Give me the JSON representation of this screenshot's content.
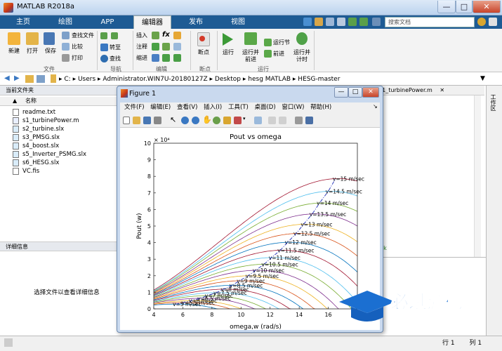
{
  "app": {
    "title": "MATLAB R2018a",
    "tabs": [
      {
        "label": "主页"
      },
      {
        "label": "绘图"
      },
      {
        "label": "APP"
      },
      {
        "label": "编辑器"
      },
      {
        "label": "发布"
      },
      {
        "label": "视图"
      }
    ],
    "search_placeholder": "搜索文档",
    "window_buttons": {
      "minimize": "—",
      "maximize": "□",
      "close": "✕"
    }
  },
  "ribbon": {
    "file": {
      "new": "新建",
      "open": "打开",
      "save": "保存",
      "find_file": "查找文件",
      "compare": "比较",
      "print": "打印",
      "section": "文件"
    },
    "nav": {
      "goto": "转至",
      "find": "查找",
      "section": "导航"
    },
    "edit": {
      "insert": "插入",
      "comment": "注释",
      "indent": "缩进",
      "fx": "fx",
      "section": "编辑"
    },
    "breakpoints": {
      "label": "断点",
      "section": "断点"
    },
    "run": {
      "run": "运行",
      "run_advance": "运行并\n前进",
      "run_section": "运行节",
      "advance": "前进",
      "run_time": "运行并\n计时",
      "section": "运行"
    }
  },
  "address": {
    "parts": [
      "C:",
      "Users",
      "Administrator.WIN7U-20180127Z",
      "Desktop",
      "hesg MATLAB",
      "HESG-master"
    ]
  },
  "file_panel": {
    "title": "当前文件夹",
    "col_name": "名称",
    "sort": "▲",
    "files": [
      "readme.txt",
      "s1_turbinePower.m",
      "s2_turbine.slx",
      "s3_PMSG.slx",
      "s4_boost.slx",
      "s5_Inverter_PSMG.slx",
      "s6_HESG.slx",
      "VC.fis"
    ]
  },
  "details": {
    "title": "详细信息",
    "message": "选择文件以查看详细信息"
  },
  "editor": {
    "tab": "s1_turbinePower.m",
    "workspace": "工作区",
    "peek": "5k"
  },
  "status": {
    "row_label": "行",
    "row": "1",
    "col_label": "列",
    "col": "1"
  },
  "figure": {
    "title": "Figure 1",
    "menu": [
      "文件(F)",
      "编辑(E)",
      "查看(V)",
      "插入(I)",
      "工具(T)",
      "桌面(D)",
      "窗口(W)",
      "帮助(H)"
    ]
  },
  "watermark": {
    "cn": "必过源码",
    "url": "Biguo100.com"
  },
  "chart_data": {
    "type": "line",
    "title": "Pout vs omega",
    "xlabel": "omega,w (rad/s)",
    "ylabel": "Pout (w)",
    "y_exponent": "× 10⁴",
    "xlim": [
      4,
      18
    ],
    "ylim": [
      0,
      100000
    ],
    "x_ticks": [
      4,
      6,
      8,
      10,
      12,
      14,
      16,
      18
    ],
    "y_ticks": [
      0,
      1,
      2,
      3,
      4,
      5,
      6,
      7,
      8,
      9,
      10
    ],
    "grid": false,
    "series": [
      {
        "name": "v=5 m/sec",
        "v": 5,
        "peak_x": 5.5,
        "peak_y": 2900
      },
      {
        "name": "v=5.5 m/sec",
        "v": 5.5,
        "peak_x": 6.1,
        "peak_y": 3900
      },
      {
        "name": "v=6 m/sec",
        "v": 6,
        "peak_x": 6.6,
        "peak_y": 5000
      },
      {
        "name": "v=6.5 m/sec",
        "v": 6.5,
        "peak_x": 7.2,
        "peak_y": 6400
      },
      {
        "name": "v=7 m/sec",
        "v": 7,
        "peak_x": 7.7,
        "peak_y": 8000
      },
      {
        "name": "v=7.5 m/sec",
        "v": 7.5,
        "peak_x": 8.3,
        "peak_y": 9800
      },
      {
        "name": "v=8 m/sec",
        "v": 8,
        "peak_x": 8.8,
        "peak_y": 11900
      },
      {
        "name": "v=8.5 m/sec",
        "v": 8.5,
        "peak_x": 9.4,
        "peak_y": 14300
      },
      {
        "name": "v=9 m/sec",
        "v": 9,
        "peak_x": 9.9,
        "peak_y": 17000
      },
      {
        "name": "v=9.5 m/sec",
        "v": 9.5,
        "peak_x": 10.5,
        "peak_y": 20000
      },
      {
        "name": "v=10 m/sec",
        "v": 10,
        "peak_x": 11.0,
        "peak_y": 23300
      },
      {
        "name": "v=10.5 m/sec",
        "v": 10.5,
        "peak_x": 11.6,
        "peak_y": 27000
      },
      {
        "name": "v=11 m/sec",
        "v": 11,
        "peak_x": 12.1,
        "peak_y": 31000
      },
      {
        "name": "v=11.5 m/sec",
        "v": 11.5,
        "peak_x": 12.7,
        "peak_y": 35400
      },
      {
        "name": "v=12 m/sec",
        "v": 12,
        "peak_x": 13.2,
        "peak_y": 40200
      },
      {
        "name": "v=12.5 m/sec",
        "v": 12.5,
        "peak_x": 13.8,
        "peak_y": 45500
      },
      {
        "name": "v=13 m/sec",
        "v": 13,
        "peak_x": 14.3,
        "peak_y": 51100
      },
      {
        "name": "v=13.5 m/sec",
        "v": 13.5,
        "peak_x": 14.9,
        "peak_y": 57300
      },
      {
        "name": "v=14 m/sec",
        "v": 14,
        "peak_x": 15.4,
        "peak_y": 63900
      },
      {
        "name": "v=14.5 m/sec",
        "v": 14.5,
        "peak_x": 16.0,
        "peak_y": 71000
      },
      {
        "name": "v=15 m/sec",
        "v": 15,
        "peak_x": 16.5,
        "peak_y": 78600
      }
    ],
    "mpp_line": {
      "style": "dash-dot",
      "color": "#1f2db8"
    },
    "colors": [
      "#0072bd",
      "#d95319",
      "#edb120",
      "#7e2f8e",
      "#77ac30",
      "#4dbeee",
      "#a2142f"
    ]
  }
}
